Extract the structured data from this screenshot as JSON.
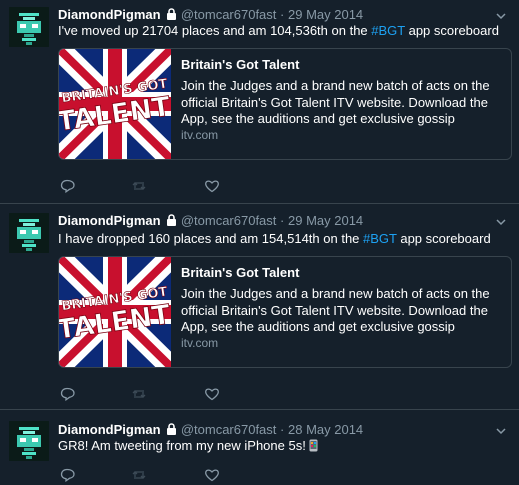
{
  "tweets": [
    {
      "name": "DiamondPigman",
      "handle": "@tomcar670fast",
      "date": "29 May 2014",
      "text_before": "I've moved up 21704 places and am 104,536th on the ",
      "hashtag": "#BGT",
      "text_after": " app scoreboard",
      "card": {
        "title": "Britain's Got Talent",
        "description": "Join the Judges and a brand new batch of acts on the official Britain's Got Talent ITV website. Download the App, see the auditions and get exclusive gossip",
        "domain": "itv.com",
        "logo_line1": "BRITAIN'S GOT",
        "logo_line2": "TALENT"
      }
    },
    {
      "name": "DiamondPigman",
      "handle": "@tomcar670fast",
      "date": "29 May 2014",
      "text_before": "I have dropped 160 places and am 154,514th on the ",
      "hashtag": "#BGT",
      "text_after": " app scoreboard",
      "card": {
        "title": "Britain's Got Talent",
        "description": "Join the Judges and a brand new batch of acts on the official Britain's Got Talent ITV website. Download the App, see the auditions and get exclusive gossip",
        "domain": "itv.com",
        "logo_line1": "BRITAIN'S GOT",
        "logo_line2": "TALENT"
      }
    },
    {
      "name": "DiamondPigman",
      "handle": "@tomcar670fast",
      "date": "28 May 2014",
      "text_before": "GR8! Am tweeting from my new iPhone 5s! ",
      "hashtag": "",
      "text_after": ""
    }
  ],
  "icons": {
    "lock": "lock-icon",
    "caret": "chevron-down-icon",
    "reply": "reply-icon",
    "retweet": "retweet-icon",
    "like": "heart-icon",
    "phone_emoji": "phone-emoji-icon"
  },
  "colors": {
    "background": "#15202b",
    "border": "#38444d",
    "secondary_text": "#8899a6",
    "link": "#1da1f2"
  }
}
